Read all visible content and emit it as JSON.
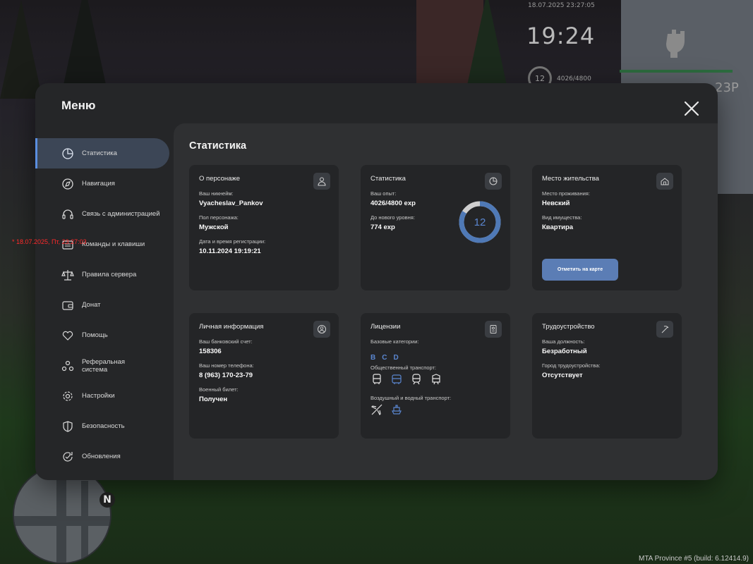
{
  "hud": {
    "date": "18.07.2025 23:27:05",
    "time": "19:24",
    "level": "12",
    "exp": "4026/4800",
    "money_fragment": "23P",
    "debug_line": "* 18.07.2025, Пт, 23:27:03",
    "build": "MTA Province #5 (build: 6.12414.9)",
    "minimap_north": "N"
  },
  "menu": {
    "title": "Меню",
    "sidebar": [
      {
        "label": "Статистика",
        "icon": "pie-chart-icon",
        "active": true
      },
      {
        "label": "Навигация",
        "icon": "compass-icon"
      },
      {
        "label": "Связь с администрацией",
        "icon": "headset-icon"
      },
      {
        "label": "Команды и клавиши",
        "icon": "keyboard-icon"
      },
      {
        "label": "Правила сервера",
        "icon": "scales-icon"
      },
      {
        "label": "Донат",
        "icon": "wallet-icon"
      },
      {
        "label": "Помощь",
        "icon": "heart-hand-icon"
      },
      {
        "label": "Реферальная система",
        "label_line1": "Реферальная",
        "label_line2": "система",
        "icon": "people-icon"
      },
      {
        "label": "Настройки",
        "icon": "gear-icon"
      },
      {
        "label": "Безопасность",
        "icon": "shield-icon"
      },
      {
        "label": "Обновления",
        "icon": "refresh-icon"
      }
    ]
  },
  "content": {
    "title": "Статистика",
    "character": {
      "title": "О персонаже",
      "nickname_label": "Ваш никнейм:",
      "nickname": "Vyacheslav_Pankov",
      "gender_label": "Пол персонажа:",
      "gender": "Мужской",
      "reg_label": "Дата и время регистрации:",
      "reg": "10.11.2024 19:19:21"
    },
    "stats": {
      "title": "Статистика",
      "exp_label": "Ваш опыт:",
      "exp": "4026/4800 exp",
      "next_label": "До нового уровня:",
      "next": "774 exp",
      "level": "12",
      "progress": 0.8388,
      "ring_color": "#4f79b6",
      "ring_rest_color": "#cfcfcf"
    },
    "residence": {
      "title": "Место жительства",
      "place_label": "Место проживания:",
      "place": "Невский",
      "property_label": "Вид имущества:",
      "property": "Квартира",
      "map_button": "Отметить на карте"
    },
    "personal": {
      "title": "Личная информация",
      "bank_label": "Ваш банковский счет:",
      "bank": "158306",
      "phone_label": "Ваш номер телефона:",
      "phone": "8 (963) 170-23-79",
      "military_label": "Военный билет:",
      "military": "Получен"
    },
    "licenses": {
      "title": "Лицензии",
      "base_label": "Базовые категории:",
      "base_categories": "BCD",
      "public_label": "Общественный транспорт:",
      "public_icons": [
        "bus-icon",
        "bus-front-icon",
        "train-icon",
        "tram-icon"
      ],
      "air_water_label": "Воздушный и водный транспорт:",
      "air_water_icons": [
        "plane-icon",
        "ship-icon"
      ]
    },
    "employment": {
      "title": "Трудоустройство",
      "position_label": "Ваша должность:",
      "position": "Безработный",
      "city_label": "Город трудоустройства:",
      "city": "Отсутствует"
    }
  },
  "colors": {
    "accent": "#5a8ee0",
    "button": "#5b7db5",
    "window": "#252628",
    "panel": "#2f3032",
    "card": "#242527"
  }
}
